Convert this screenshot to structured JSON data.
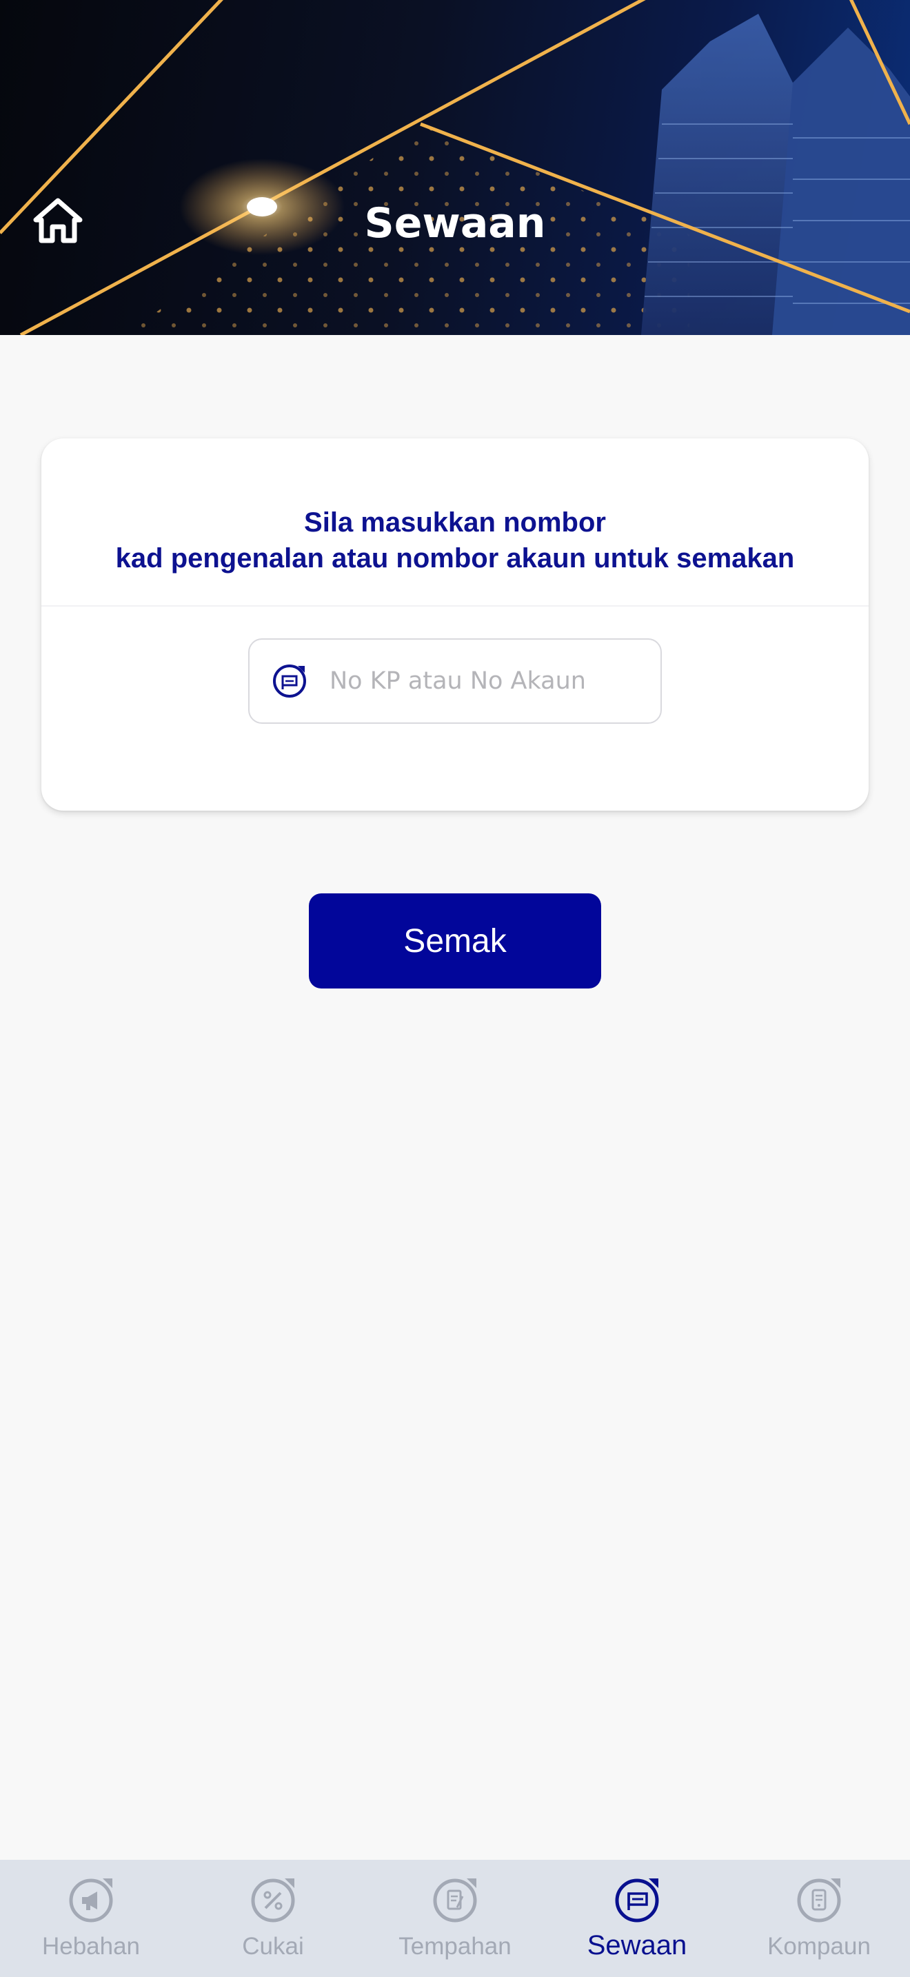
{
  "header": {
    "title": "Sewaan",
    "home_icon": "home-icon"
  },
  "card": {
    "instruction_line1": "Sila masukkan nombor",
    "instruction_line2": "kad pengenalan atau nombor akaun untuk semakan",
    "input": {
      "icon": "rental-sign-icon",
      "placeholder": "No KP atau No Akaun",
      "value": ""
    }
  },
  "check_button_label": "Semak",
  "bottom_nav": {
    "items": [
      {
        "label": "Hebahan",
        "icon": "megaphone-icon",
        "active": false
      },
      {
        "label": "Cukai",
        "icon": "tax-icon",
        "active": false
      },
      {
        "label": "Tempahan",
        "icon": "booking-icon",
        "active": false
      },
      {
        "label": "Sewaan",
        "icon": "rental-sign-icon",
        "active": true
      },
      {
        "label": "Kompaun",
        "icon": "compound-icon",
        "active": false
      }
    ]
  },
  "colors": {
    "primary": "#02069a",
    "title_text": "#0d1290",
    "nav_inactive": "#a3a9b5",
    "nav_background": "#dde2ea"
  }
}
